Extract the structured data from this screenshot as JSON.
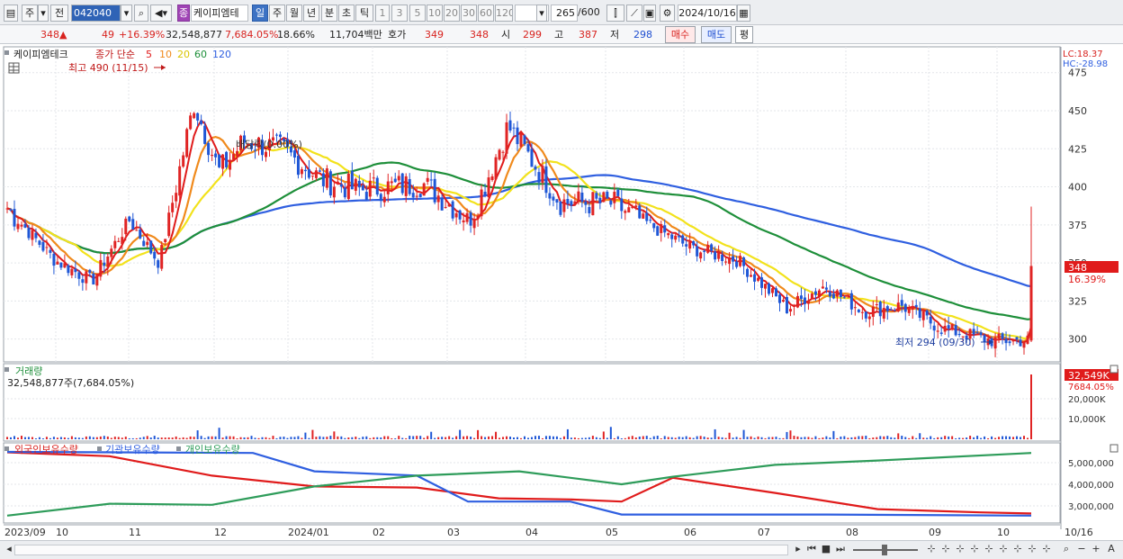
{
  "toolbar": {
    "market_label": "주",
    "prev_label": "전",
    "code": "042040",
    "name": "케이피엠테",
    "badge": "종",
    "periods": [
      "일",
      "주",
      "월",
      "년",
      "분",
      "초",
      "틱"
    ],
    "intervals": [
      "1",
      "3",
      "5",
      "10",
      "20",
      "30",
      "60",
      "120"
    ],
    "count": "265",
    "count_max": "/600",
    "date": "2024/10/16"
  },
  "quote": {
    "price": "348",
    "change": "49",
    "change_rate": "+16.39%",
    "volume": "32,548,877",
    "volume_ratio": "7,684.05%",
    "turnover": "18.66%",
    "amount": "11,704백만",
    "ask_label": "호가",
    "ask": "349",
    "bid": "348",
    "open_label": "시",
    "open": "299",
    "high_label": "고",
    "high": "387",
    "low_label": "저",
    "low": "298",
    "buy_button": "매수",
    "sell_button": "매도",
    "avg_button": "평"
  },
  "price_panel": {
    "legend_name": "케이피엠테크",
    "legend_type": "종가 단순",
    "ma_periods": [
      "5",
      "10",
      "20",
      "60",
      "120"
    ],
    "lc": "LC:18.37",
    "hc": "HC:-28.98",
    "high_note": "최고 490 (11/15)",
    "low_note": "최저 294 (09/30)",
    "ex_note": "배당락(0.00%)",
    "last_price_tag": "348",
    "last_rate_tag": "16.39%",
    "y_ticks": [
      "475",
      "450",
      "425",
      "400",
      "375",
      "350",
      "325",
      "300"
    ]
  },
  "volume_panel": {
    "title": "거래량",
    "value": "32,548,877주(7,684.05%)",
    "tag_value": "32,549K",
    "tag_rate": "7684.05%",
    "y_ticks": [
      "20,000K",
      "10,000K"
    ]
  },
  "holding_panel": {
    "series_names": [
      "외국인보유수량",
      "기관보유수량",
      "개인보유수량"
    ],
    "y_ticks": [
      "5,000,000",
      "4,000,000",
      "3,000,000"
    ]
  },
  "x_axis": {
    "labels": [
      "2023/09",
      "10",
      "11",
      "12",
      "2024/01",
      "02",
      "03",
      "04",
      "05",
      "06",
      "07",
      "08",
      "09",
      "10",
      "10/16"
    ]
  },
  "colors": {
    "up": "#e02424",
    "down": "#1f57d6",
    "ma5": "#e01b1b",
    "ma10": "#f08a1c",
    "ma20": "#f2e21c",
    "ma60": "#1e8f3a",
    "ma120": "#2f5fe0",
    "foreign": "#e01b1b",
    "institution": "#2f5fe0",
    "individual": "#2e9c5a"
  },
  "chart_data": {
    "type": "candlestick",
    "price_range": [
      285,
      492
    ],
    "anchors": [
      {
        "date": "2023-09-01",
        "close": 386
      },
      {
        "date": "2023-09-20",
        "close": 352
      },
      {
        "date": "2023-10-05",
        "close": 338
      },
      {
        "date": "2023-10-20",
        "close": 378
      },
      {
        "date": "2023-11-01",
        "close": 350
      },
      {
        "date": "2023-11-15",
        "close": 455
      },
      {
        "date": "2023-11-25",
        "close": 410
      },
      {
        "date": "2023-12-05",
        "close": 430
      },
      {
        "date": "2023-12-20",
        "close": 425
      },
      {
        "date": "2024-01-05",
        "close": 405
      },
      {
        "date": "2024-01-20",
        "close": 398
      },
      {
        "date": "2024-02-15",
        "close": 402
      },
      {
        "date": "2024-03-05",
        "close": 378
      },
      {
        "date": "2024-03-20",
        "close": 440
      },
      {
        "date": "2024-04-10",
        "close": 390
      },
      {
        "date": "2024-05-01",
        "close": 389
      },
      {
        "date": "2024-06-01",
        "close": 360
      },
      {
        "date": "2024-06-20",
        "close": 352
      },
      {
        "date": "2024-07-10",
        "close": 320
      },
      {
        "date": "2024-07-25",
        "close": 335
      },
      {
        "date": "2024-08-10",
        "close": 318
      },
      {
        "date": "2024-08-25",
        "close": 322
      },
      {
        "date": "2024-09-10",
        "close": 307
      },
      {
        "date": "2024-09-30",
        "close": 299
      },
      {
        "date": "2024-10-15",
        "close": 299
      },
      {
        "date": "2024-10-16",
        "close": 348
      }
    ],
    "holdings_millions": {
      "foreign": [
        [
          0,
          5.48
        ],
        [
          0.1,
          5.3
        ],
        [
          0.2,
          4.4
        ],
        [
          0.3,
          3.9
        ],
        [
          0.4,
          3.85
        ],
        [
          0.48,
          3.35
        ],
        [
          0.55,
          3.3
        ],
        [
          0.6,
          3.2
        ],
        [
          0.65,
          4.3
        ],
        [
          0.75,
          3.6
        ],
        [
          0.85,
          2.85
        ],
        [
          0.95,
          2.7
        ],
        [
          1,
          2.65
        ]
      ],
      "institution": [
        [
          0,
          5.5
        ],
        [
          0.24,
          5.45
        ],
        [
          0.3,
          4.6
        ],
        [
          0.4,
          4.4
        ],
        [
          0.45,
          3.2
        ],
        [
          0.55,
          3.2
        ],
        [
          0.6,
          2.6
        ],
        [
          0.8,
          2.6
        ],
        [
          1,
          2.55
        ]
      ],
      "individual": [
        [
          0,
          2.55
        ],
        [
          0.1,
          3.1
        ],
        [
          0.2,
          3.05
        ],
        [
          0.3,
          3.9
        ],
        [
          0.4,
          4.4
        ],
        [
          0.5,
          4.6
        ],
        [
          0.6,
          4.0
        ],
        [
          0.65,
          4.35
        ],
        [
          0.75,
          4.9
        ],
        [
          0.85,
          5.1
        ],
        [
          1,
          5.45
        ]
      ]
    }
  }
}
